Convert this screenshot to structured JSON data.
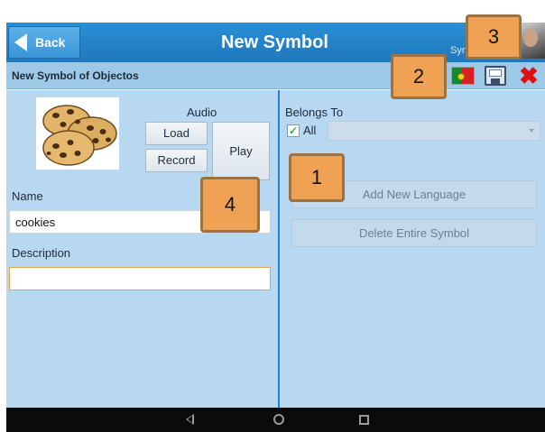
{
  "topbar": {
    "back_label": "Back",
    "title": "New Symbol",
    "user_text": "Syn"
  },
  "subbar": {
    "title": "New Symbol of Objectos"
  },
  "left_panel": {
    "audio_label": "Audio",
    "load_label": "Load",
    "record_label": "Record",
    "play_label": "Play",
    "name_label": "Name",
    "name_value": "cookies",
    "description_label": "Description",
    "description_value": ""
  },
  "right_panel": {
    "belongs_to_label": "Belongs To",
    "all_label": "All",
    "all_checked": true,
    "checkmark": "✓",
    "add_language_label": "Add New Language",
    "delete_symbol_label": "Delete Entire Symbol"
  },
  "callouts": [
    "1",
    "2",
    "3",
    "4"
  ],
  "icons": {
    "back": "back-arrow-icon",
    "flag": "portugal-flag-icon",
    "save": "floppy-disk-icon",
    "close": "red-x-icon",
    "close_glyph": "✖"
  },
  "colors": {
    "topbar": "#2a8fd4",
    "subbar": "#9ec9e6",
    "content": "#b7d8f0",
    "callout": "#f0a254",
    "close": "#dd1111"
  }
}
